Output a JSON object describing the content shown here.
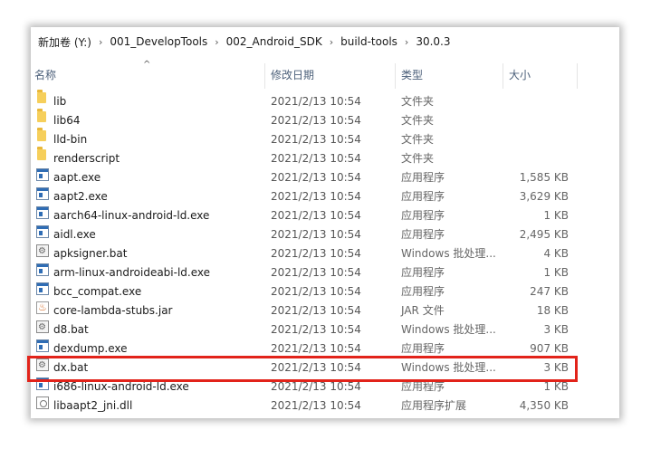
{
  "breadcrumb": [
    "新加卷 (Y:)",
    "001_DevelopTools",
    "002_Android_SDK",
    "build-tools",
    "30.0.3"
  ],
  "breadcrumb_sep": "›",
  "columns": {
    "name": "名称",
    "date": "修改日期",
    "type": "类型",
    "size": "大小"
  },
  "sort_indicator": "^",
  "files": [
    {
      "name": "lib",
      "date": "2021/2/13 10:54",
      "type": "文件夹",
      "size": "",
      "icon": "folder-icon"
    },
    {
      "name": "lib64",
      "date": "2021/2/13 10:54",
      "type": "文件夹",
      "size": "",
      "icon": "folder-icon"
    },
    {
      "name": "lld-bin",
      "date": "2021/2/13 10:54",
      "type": "文件夹",
      "size": "",
      "icon": "folder-icon"
    },
    {
      "name": "renderscript",
      "date": "2021/2/13 10:54",
      "type": "文件夹",
      "size": "",
      "icon": "folder-icon"
    },
    {
      "name": "aapt.exe",
      "date": "2021/2/13 10:54",
      "type": "应用程序",
      "size": "1,585 KB",
      "icon": "exe-icon"
    },
    {
      "name": "aapt2.exe",
      "date": "2021/2/13 10:54",
      "type": "应用程序",
      "size": "3,629 KB",
      "icon": "exe-icon"
    },
    {
      "name": "aarch64-linux-android-ld.exe",
      "date": "2021/2/13 10:54",
      "type": "应用程序",
      "size": "1 KB",
      "icon": "exe-icon"
    },
    {
      "name": "aidl.exe",
      "date": "2021/2/13 10:54",
      "type": "应用程序",
      "size": "2,495 KB",
      "icon": "exe-icon"
    },
    {
      "name": "apksigner.bat",
      "date": "2021/2/13 10:54",
      "type": "Windows 批处理...",
      "size": "4 KB",
      "icon": "bat-icon"
    },
    {
      "name": "arm-linux-androideabi-ld.exe",
      "date": "2021/2/13 10:54",
      "type": "应用程序",
      "size": "1 KB",
      "icon": "exe-icon"
    },
    {
      "name": "bcc_compat.exe",
      "date": "2021/2/13 10:54",
      "type": "应用程序",
      "size": "247 KB",
      "icon": "exe-icon"
    },
    {
      "name": "core-lambda-stubs.jar",
      "date": "2021/2/13 10:54",
      "type": "JAR 文件",
      "size": "18 KB",
      "icon": "jar-icon"
    },
    {
      "name": "d8.bat",
      "date": "2021/2/13 10:54",
      "type": "Windows 批处理...",
      "size": "3 KB",
      "icon": "bat-icon"
    },
    {
      "name": "dexdump.exe",
      "date": "2021/2/13 10:54",
      "type": "应用程序",
      "size": "907 KB",
      "icon": "exe-icon"
    },
    {
      "name": "dx.bat",
      "date": "2021/2/13 10:54",
      "type": "Windows 批处理...",
      "size": "3 KB",
      "icon": "bat-icon"
    },
    {
      "name": "i686-linux-android-ld.exe",
      "date": "2021/2/13 10:54",
      "type": "应用程序",
      "size": "1 KB",
      "icon": "exe-icon"
    },
    {
      "name": "libaapt2_jni.dll",
      "date": "2021/2/13 10:54",
      "type": "应用程序扩展",
      "size": "4,350 KB",
      "icon": "dll-icon"
    }
  ],
  "highlighted_file": "dx.bat",
  "highlight_color": "#e2231a"
}
